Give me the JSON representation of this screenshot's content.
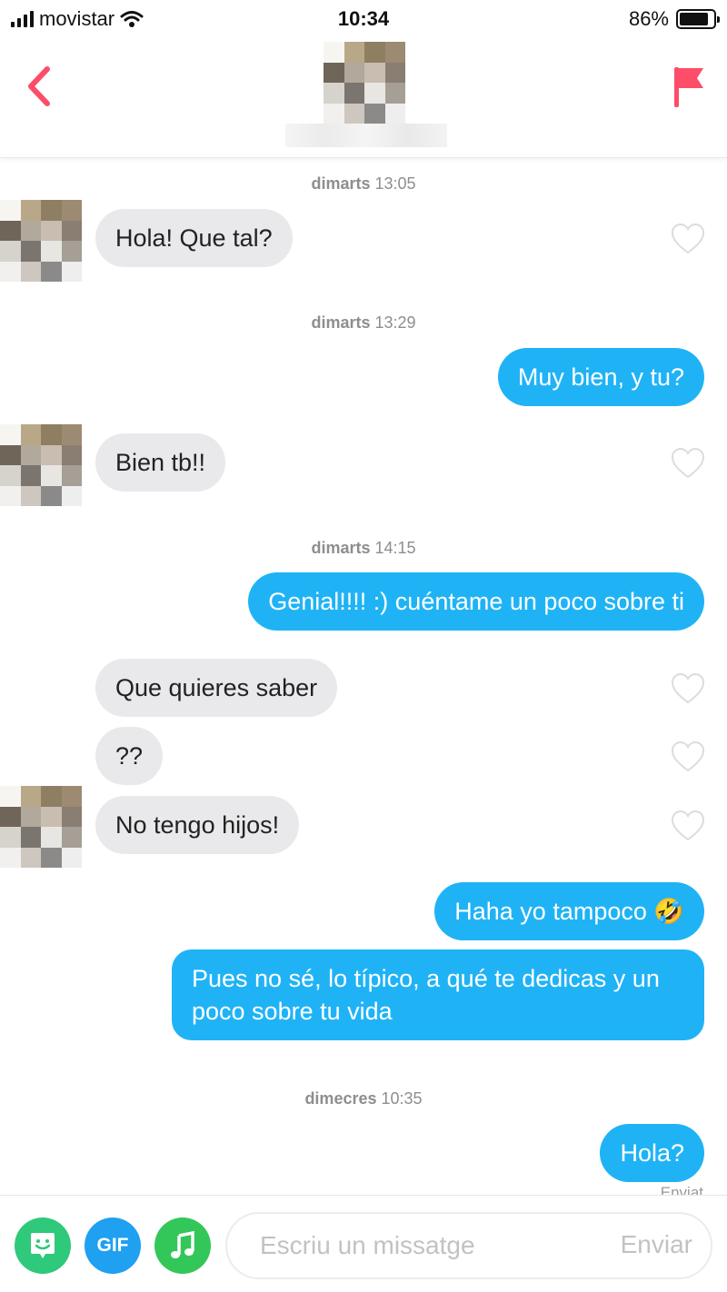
{
  "status_bar": {
    "carrier": "movistar",
    "time": "10:34",
    "battery_percent_text": "86%",
    "battery_level": 0.86
  },
  "header": {
    "back_icon": "chevron-left-icon",
    "report_icon": "flag-icon",
    "accent_color": "#fd4d68"
  },
  "messages": {
    "ts1": {
      "day": "dimarts",
      "time": "13:05"
    },
    "m1": "Hola! Que tal?",
    "ts2": {
      "day": "dimarts",
      "time": "13:29"
    },
    "m2": "Muy bien, y tu?",
    "m3": "Bien tb!!",
    "ts3": {
      "day": "dimarts",
      "time": "14:15"
    },
    "m4": "Genial!!!! :) cuéntame un poco sobre ti",
    "m5": "Que quieres saber",
    "m6": "??",
    "m7": "No tengo hijos!",
    "m8": "Haha yo tampoco 🤣",
    "m9": "Pues no sé, lo típico, a qué te dedicas y un poco sobre tu vida",
    "ts4": {
      "day": "dimecres",
      "time": "10:35"
    },
    "m10": "Hola?",
    "sent_status": "Enviat"
  },
  "input_bar": {
    "placeholder": "Escriu un missatge",
    "send_label": "Enviar",
    "gif_label": "GIF",
    "sticker_icon": "bitmoji-sticker-icon",
    "music_icon": "music-note-icon",
    "colors": {
      "sticker": "#2ec97a",
      "gif": "#1fa0f1",
      "music": "#33c759"
    }
  },
  "colors": {
    "outgoing_bubble": "#1fb3f6",
    "incoming_bubble": "#e9e9eb"
  }
}
